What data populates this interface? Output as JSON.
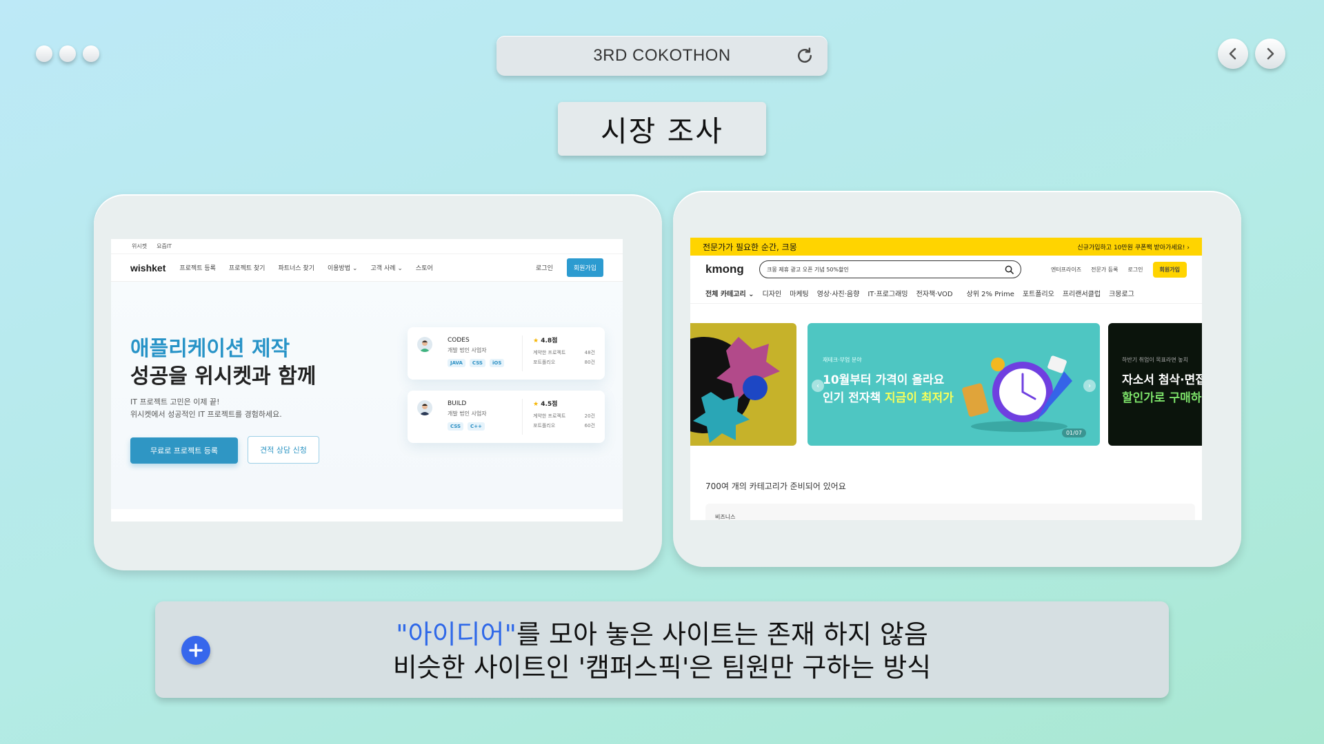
{
  "window": {
    "title": "3RD COKOTHON",
    "heading": "시장 조사"
  },
  "wishket": {
    "topbar": [
      "위시켓",
      "요즘IT"
    ],
    "logo": "wishket",
    "menu": [
      "프로젝트 등록",
      "프로젝트 찾기",
      "파트너스 찾기",
      "이용방법 ⌄",
      "고객 사례 ⌄",
      "스토어"
    ],
    "login": "로그인",
    "signup": "회원가입",
    "headline_1": "애플리케이션 제작",
    "headline_2": "성공을 위시켓과 함께",
    "desc_1": "IT 프로젝트 고민은 이제 끝!",
    "desc_2": "위시켓에서 성공적인 IT 프로젝트를 경험하세요.",
    "cta_primary": "무료로 프로젝트 등록",
    "cta_secondary": "견적 상담 신청",
    "partners": [
      {
        "name": "CODES",
        "meta": "개발    법인 사업자",
        "tags": [
          "JAVA",
          "CSS",
          "iOS"
        ],
        "rating": "4.8점",
        "contracts_label": "계약한 프로젝트",
        "contracts": "48건",
        "portfolio_label": "포트폴리오",
        "portfolio": "80건"
      },
      {
        "name": "BUILD",
        "meta": "개발    법인 사업자",
        "tags": [
          "CSS",
          "C++"
        ],
        "rating": "4.5점",
        "contracts_label": "계약한 프로젝트",
        "contracts": "20건",
        "portfolio_label": "포트폴리오",
        "portfolio": "60건"
      }
    ]
  },
  "kmong": {
    "banner_left": "전문가가 필요한 순간, 크몽",
    "banner_right": "신규가입하고 10만원 쿠폰팩 받아가세요! ›",
    "logo": "kmong",
    "search_placeholder": "크몽 제휴 광고 오픈 기념 50%할인",
    "header_links": [
      "엔터프라이즈",
      "전문가 등록",
      "로그인"
    ],
    "join": "회원가입",
    "categories": [
      "전체 카테고리 ⌄",
      "디자인",
      "마케팅",
      "영상·사진·음향",
      "IT·프로그래밍",
      "전자책·VOD",
      "상위 2% Prime",
      "포트폴리오",
      "프리랜서클럽",
      "크몽로그"
    ],
    "slide_main": {
      "small": "재테크·부업 분야",
      "line1": "10월부터 가격이 올라요",
      "line2_a": "인기 전자책 ",
      "line2_b": "지금이 최저가",
      "counter": "01/07"
    },
    "slide_next": {
      "small": "하반기 취업이 목표라면 놓치",
      "line1": "자소서 첨삭·면접",
      "line2": "할인가로 구매하기"
    },
    "section_title": "700여 개의 카테고리가 준비되어 있어요",
    "section_item": "비즈니스"
  },
  "note": {
    "quote": "\"아이디어\"",
    "line1_rest": "를 모아 놓은 사이트는 존재 하지 않음",
    "line2": "비슷한 사이트인 '캠퍼스픽'은 팀원만 구하는 방식"
  },
  "colors": {
    "wishket_accent": "#2c9bd0",
    "kmong_yellow": "#ffd400",
    "note_highlight": "#2f68e8",
    "plus_button": "#3767ec"
  },
  "icons": [
    "window-dot-icon",
    "reload-icon",
    "chevron-left-icon",
    "chevron-right-icon",
    "plus-icon",
    "search-icon",
    "star-icon"
  ]
}
